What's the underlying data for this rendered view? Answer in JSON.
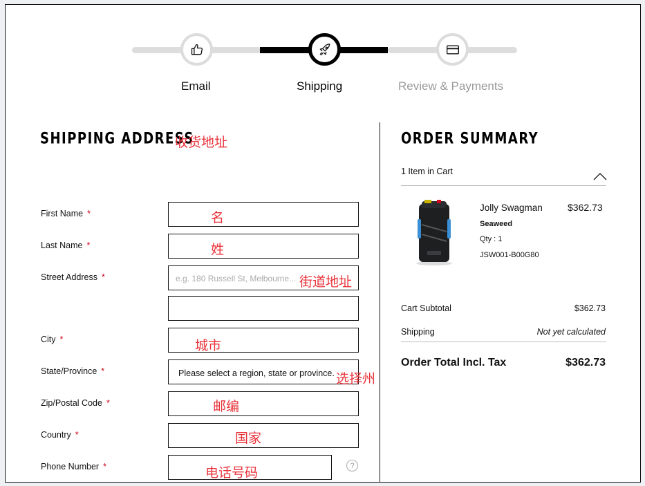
{
  "steps": [
    {
      "label": "Email",
      "icon": "thumbs-up-icon",
      "state": "done"
    },
    {
      "label": "Shipping",
      "icon": "rocket-icon",
      "state": "active"
    },
    {
      "label": "Review & Payments",
      "icon": "credit-card-icon",
      "state": "upcoming"
    }
  ],
  "shipping": {
    "heading": "SHIPPING ADDRESS",
    "heading_annotation": "收货地址",
    "required_mark": "*",
    "fields": {
      "first_name": {
        "label": "First Name",
        "annotation": "名"
      },
      "last_name": {
        "label": "Last Name",
        "annotation": "姓"
      },
      "street": {
        "label": "Street Address",
        "placeholder": "e.g. 180 Russell St, Melbourne...",
        "annotation": "街道地址"
      },
      "city": {
        "label": "City",
        "annotation": "城市"
      },
      "state": {
        "label": "State/Province",
        "value": "Please select a region, state or province.",
        "annotation": "选择州"
      },
      "zip": {
        "label": "Zip/Postal Code",
        "annotation": "邮编"
      },
      "country": {
        "label": "Country",
        "annotation": "国家"
      },
      "phone": {
        "label": "Phone Number",
        "annotation": "电话号码",
        "help": "?"
      }
    }
  },
  "summary": {
    "heading": "ORDER SUMMARY",
    "items_count": "1 Item in Cart",
    "item": {
      "name": "Jolly Swagman",
      "price": "$362.73",
      "color": "Seaweed",
      "qty": "Qty : 1",
      "sku": "JSW001-B00G80"
    },
    "subtotal_label": "Cart Subtotal",
    "subtotal_value": "$362.73",
    "shipping_label": "Shipping",
    "shipping_value": "Not yet calculated",
    "total_label": "Order Total Incl. Tax",
    "total_value": "$362.73"
  },
  "colors": {
    "annotation": "#e8333a",
    "required": "#d0021b",
    "step_inactive": "#dcdcdc"
  }
}
